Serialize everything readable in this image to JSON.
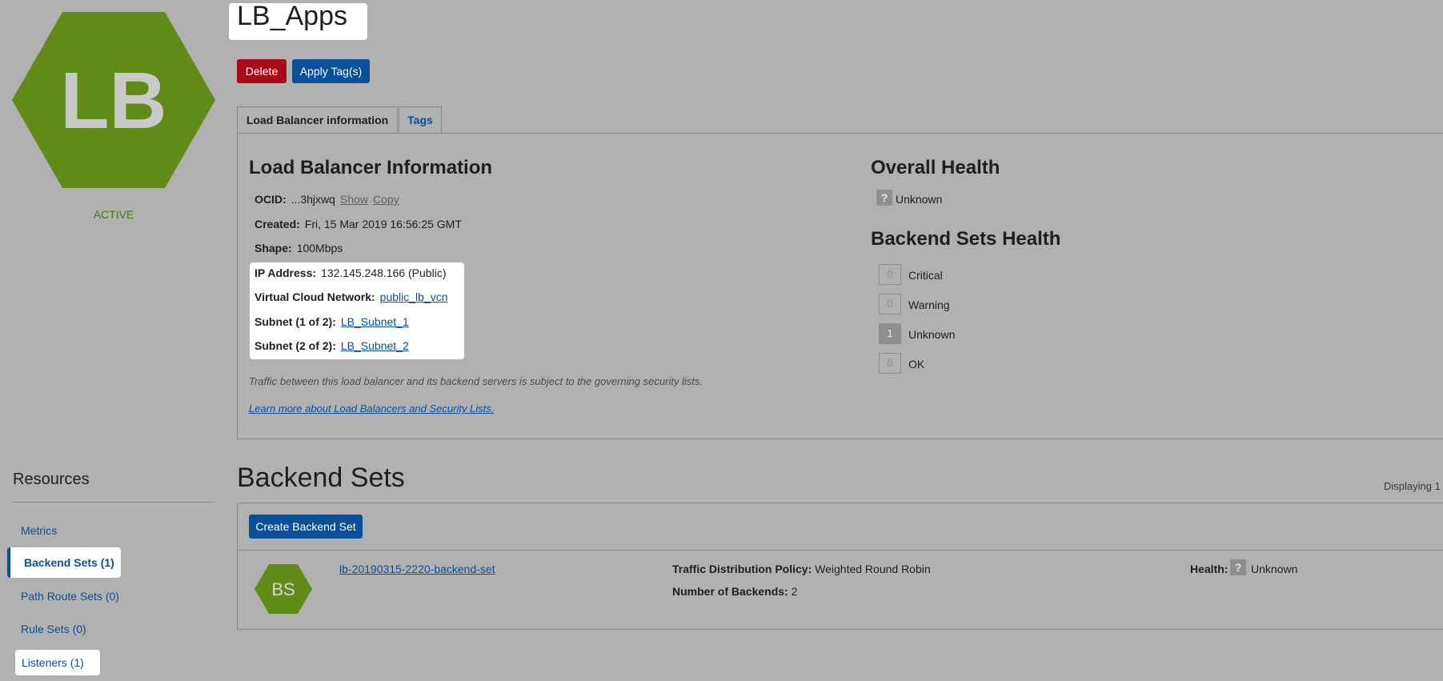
{
  "logo": {
    "text": "LB",
    "color": "#5f8b16"
  },
  "state": "ACTIVE",
  "title": "LB_Apps",
  "buttons": {
    "delete": "Delete",
    "apply_tags": "Apply Tag(s)"
  },
  "tabs": {
    "info": "Load Balancer information",
    "tags": "Tags"
  },
  "info": {
    "heading": "Load Balancer Information",
    "ocid_label": "OCID:",
    "ocid_value": "...3hjxwq",
    "show": "Show",
    "copy": "Copy",
    "created_label": "Created:",
    "created_value": "Fri, 15 Mar 2019 16:56:25 GMT",
    "shape_label": "Shape:",
    "shape_value": "100Mbps",
    "ip_label": "IP Address:",
    "ip_value": "132.145.248.166 (Public)",
    "vcn_label": "Virtual Cloud Network:",
    "vcn_value": "public_lb_vcn",
    "subnet1_label": "Subnet (1 of 2):",
    "subnet1_value": "LB_Subnet_1",
    "subnet2_label": "Subnet (2 of 2):",
    "subnet2_value": "LB_Subnet_2",
    "note": "Traffic between this load balancer and its backend servers is subject to the governing security lists.",
    "learn_more": "Learn more about Load Balancers and Security Lists."
  },
  "health": {
    "overall_heading": "Overall Health",
    "overall_icon": "?",
    "overall_value": "Unknown",
    "sets_heading": "Backend Sets Health",
    "counts": [
      {
        "value": "0",
        "label": "Critical",
        "filled": false
      },
      {
        "value": "0",
        "label": "Warning",
        "filled": false
      },
      {
        "value": "1",
        "label": "Unknown",
        "filled": true
      },
      {
        "value": "0",
        "label": "OK",
        "filled": false
      }
    ]
  },
  "resources": {
    "title": "Resources",
    "items": [
      "Metrics",
      "Backend Sets (1)",
      "Path Route Sets (0)",
      "Rule Sets (0)",
      "Listeners (1)"
    ]
  },
  "backend_sets": {
    "heading": "Backend Sets",
    "displaying": "Displaying 1",
    "create": "Create Backend Set",
    "item": {
      "icon_text": "BS",
      "name": "lb-20190315-2220-backend-set",
      "policy_label": "Traffic Distribution Policy:",
      "policy_value": "Weighted Round Robin",
      "backends_label": "Number of Backends:",
      "backends_value": "2",
      "health_label": "Health:",
      "health_icon": "?",
      "health_value": "Unknown"
    }
  }
}
